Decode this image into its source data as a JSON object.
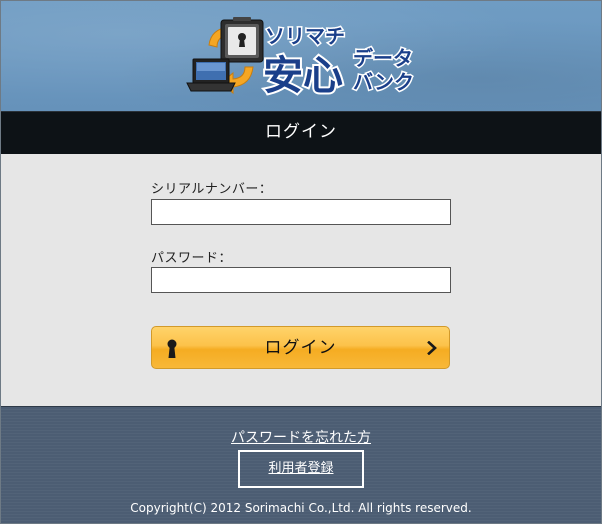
{
  "header": {
    "logo_line1": "ソリマチ",
    "logo_big": "安心",
    "logo_line2": "データ",
    "logo_line3": "バンク"
  },
  "title_bar": {
    "title": "ログイン"
  },
  "form": {
    "serial": {
      "label": "シリアルナンバー：",
      "value": "",
      "placeholder": ""
    },
    "password": {
      "label": "パスワード：",
      "value": "",
      "placeholder": ""
    },
    "login_button_label": "ログイン"
  },
  "footer": {
    "forgot_password": "パスワードを忘れた方",
    "register_button": "利用者登録",
    "copyright": "Copyright(C) 2012 Sorimachi Co.,Ltd. All rights reserved."
  },
  "colors": {
    "header_blue": "#6b98c0",
    "title_bar_black": "#0d1216",
    "form_gray": "#e6e6e6",
    "button_orange": "#fcc24a",
    "footer_slate": "#4c5d73",
    "logo_dark_blue": "#1a3f8a"
  },
  "icons": {
    "logo_emblem": "laptop-safe-arrows-icon",
    "login_left": "keyhole-icon",
    "login_right": "chevron-right-icon"
  }
}
